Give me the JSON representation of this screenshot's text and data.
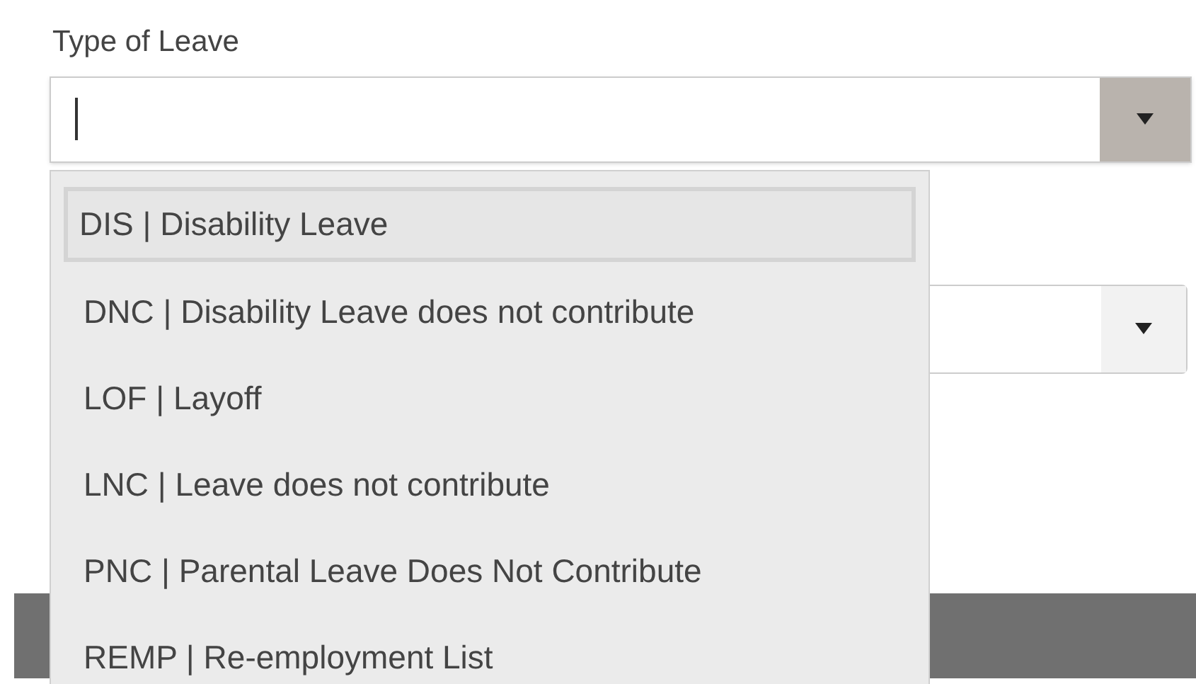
{
  "field": {
    "label": "Type of Leave",
    "expanded": true
  },
  "options": [
    {
      "label": "DIS | Disability Leave",
      "selected": true
    },
    {
      "label": "DNC | Disability Leave does not contribute",
      "selected": false
    },
    {
      "label": "LOF | Layoff",
      "selected": false
    },
    {
      "label": "LNC | Leave does not contribute",
      "selected": false
    },
    {
      "label": "PNC | Parental Leave Does Not Contribute",
      "selected": false
    },
    {
      "label": "REMP | Re-employment List",
      "selected": false
    }
  ]
}
